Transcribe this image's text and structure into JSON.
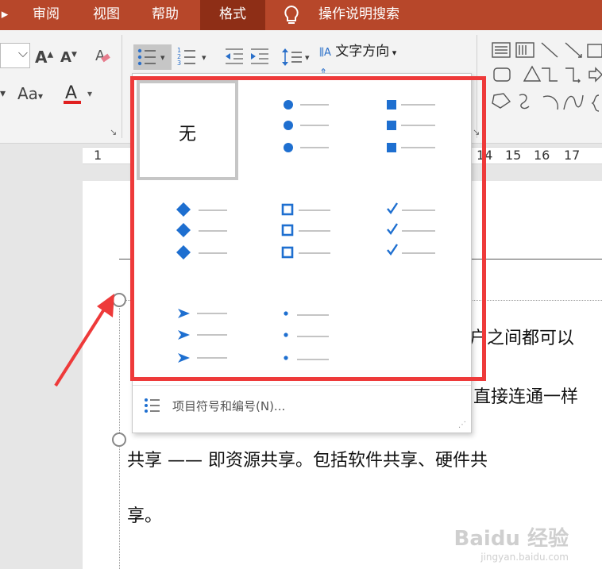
{
  "tabs": [
    {
      "label": "审阅"
    },
    {
      "label": "视图"
    },
    {
      "label": "帮助"
    },
    {
      "label": "格式"
    },
    {
      "label": "操作说明搜索"
    }
  ],
  "ribbon": {
    "text_direction": "文字方向",
    "ruler_ticks": [
      "1",
      "14",
      "15",
      "16",
      "17"
    ]
  },
  "bullet_menu": {
    "none_label": "无",
    "bullets": [
      "filled-circle",
      "filled-square",
      "diamond",
      "hollow-square",
      "checkmark",
      "arrowhead",
      "small-dot"
    ],
    "footer_label": "项目符号和编号(N)..."
  },
  "document": {
    "lines": [
      "户之间都可以",
      "直接连通一样",
      "共享 —— 即资源共享。包括软件共享、硬件共",
      "享。"
    ]
  },
  "watermark": "Baidu 经验",
  "watermark_sub": "jingyan.baidu.com",
  "colors": {
    "accent": "#b7472a",
    "bullet": "#1e6fd0",
    "highlight": "#ee3a3a"
  }
}
